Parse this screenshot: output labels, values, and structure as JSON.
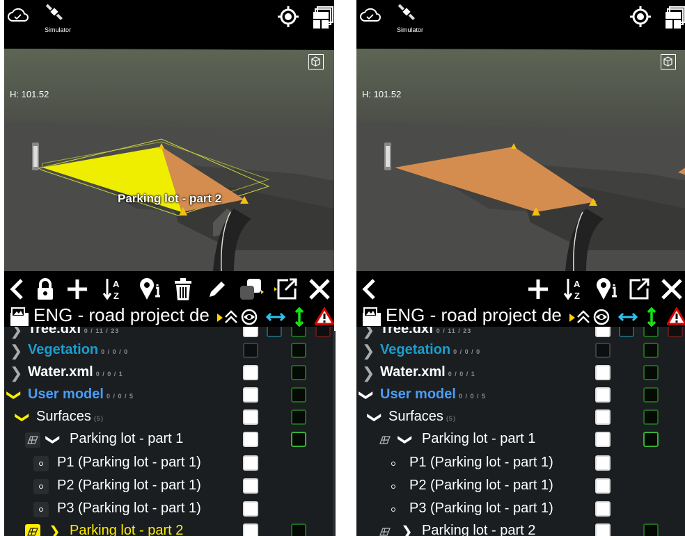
{
  "screens": {
    "left": {
      "viewport": {
        "simulator_label": "Simulator",
        "height_label": "H: 101.52",
        "object_label": "Parking lot - part 2",
        "selected": true
      },
      "header": {
        "title": "ENG - road project de"
      },
      "tree": {
        "rows": [
          {
            "label": "Tree.dxf",
            "count": "0 / 11 / 23"
          },
          {
            "label": "Vegetation",
            "count": "0 / 0 / 0"
          },
          {
            "label": "Water.xml",
            "count": "0 / 0 / 1"
          },
          {
            "label": "User model",
            "count": "0 / 0 / 5"
          },
          {
            "label": "Surfaces",
            "count": "(5)"
          },
          {
            "label": "Parking lot - part 1"
          },
          {
            "label": "P1 (Parking lot - part 1)"
          },
          {
            "label": "P2 (Parking lot - part 1)"
          },
          {
            "label": "P3 (Parking lot - part 1)"
          },
          {
            "label": "Parking lot - part 2"
          }
        ]
      }
    },
    "right": {
      "viewport": {
        "simulator_label": "Simulator",
        "height_label": "H: 101.52",
        "selected": false
      },
      "header": {
        "title": "ENG - road project de"
      },
      "tree": {
        "rows": [
          {
            "label": "Tree.dxf",
            "count": "0 / 11 / 23"
          },
          {
            "label": "Vegetation",
            "count": "0 / 0 / 0"
          },
          {
            "label": "Water.xml",
            "count": "0 / 0 / 1"
          },
          {
            "label": "User model",
            "count": "0 / 0 / 5"
          },
          {
            "label": "Surfaces",
            "count": "(5)"
          },
          {
            "label": "Parking lot - part 1"
          },
          {
            "label": "P1 (Parking lot - part 1)"
          },
          {
            "label": "P2 (Parking lot - part 1)"
          },
          {
            "label": "P3 (Parking lot - part 1)"
          },
          {
            "label": "Parking lot - part 2"
          }
        ]
      }
    }
  },
  "icons": {
    "top": [
      "cloud-check-icon",
      "satellite-icon",
      "gps-locate-icon",
      "layers-icon",
      "view-cube-icon"
    ],
    "toolbar_left": [
      "back-icon",
      "lock-icon",
      "add-icon",
      "sort-az-icon",
      "point-info-icon",
      "delete-icon",
      "edit-icon",
      "copy-icon",
      "open-external-icon",
      "close-icon"
    ],
    "toolbar_right": [
      "back-icon",
      "add-icon",
      "sort-az-icon",
      "point-info-icon",
      "open-external-icon",
      "close-icon"
    ],
    "header": [
      "project-folder-icon",
      "collapse-all-icon",
      "visibility-icon",
      "horizontal-arrows-icon",
      "vertical-arrows-icon",
      "warning-icon"
    ]
  },
  "colors": {
    "vegetation_label": "#1a9ed0",
    "user_model_label": "#4a9cf5",
    "selected_yellow": "#ffee00",
    "surface_orange": "#dc8c4a",
    "tree_bg": "#1b1e20"
  }
}
